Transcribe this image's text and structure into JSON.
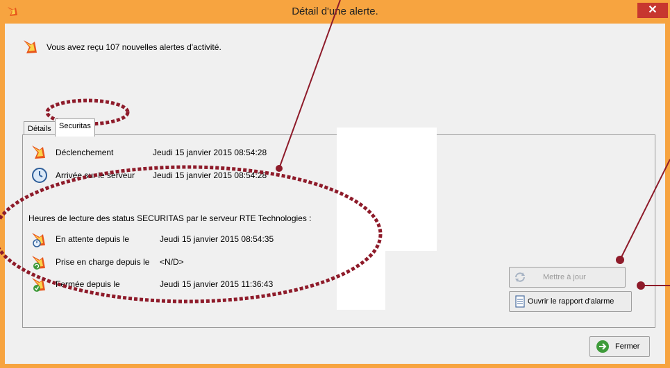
{
  "window": {
    "title": "Détail d'une alerte.",
    "close_label": "✕"
  },
  "info": {
    "message": "Vous avez reçu 107 nouvelles alertes d'activité."
  },
  "tabs": [
    {
      "label": "Détails",
      "active": false
    },
    {
      "label": "Securitas",
      "active": true
    }
  ],
  "details": {
    "declenchement": {
      "label": "Déclenchement",
      "value": "Jeudi 15 janvier 2015 08:54:28"
    },
    "arrivee": {
      "label": "Arrivée sur le serveur",
      "value": "Jeudi 15 janvier 2015 08:54:28"
    },
    "heading": "Heures de lecture des status SECURITAS par le serveur RTE Technologies :",
    "attente": {
      "label": "En attente depuis le",
      "value": "Jeudi 15 janvier 2015 08:54:35"
    },
    "prise": {
      "label": "Prise en charge depuis le",
      "value": "<N/D>"
    },
    "fermee": {
      "label": "Fermée depuis le",
      "value": "Jeudi 15 janvier 2015 11:36:43"
    }
  },
  "buttons": {
    "update": "Mettre à jour",
    "report": "Ouvrir le rapport d'alarme",
    "close": "Fermer"
  },
  "colors": {
    "titlebar": "#f7a440",
    "close_button": "#c7372f",
    "annotation": "#8e1b2a"
  },
  "icons": {
    "app": "alert-arrow-icon",
    "info": "alert-arrow-icon",
    "declenchement": "alert-arrow-icon",
    "arrivee": "clock-icon",
    "attente": "folder-clock-icon",
    "prise": "folder-refresh-icon",
    "fermee": "folder-check-icon",
    "update": "refresh-icon",
    "report": "document-icon",
    "close": "green-arrow-icon"
  }
}
